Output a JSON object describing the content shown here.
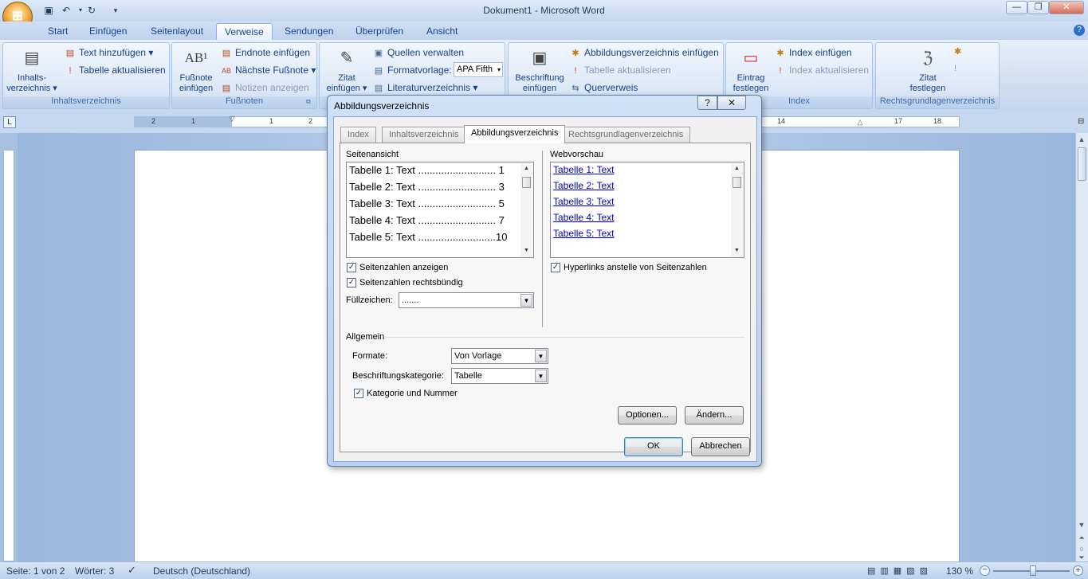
{
  "window": {
    "title": "Dokument1 - Microsoft Word"
  },
  "qat": {
    "save_icon": "save-icon",
    "undo_icon": "undo-icon",
    "redo_icon": "redo-icon"
  },
  "tabs": [
    "Start",
    "Einfügen",
    "Seitenlayout",
    "Verweise",
    "Sendungen",
    "Überprüfen",
    "Ansicht"
  ],
  "active_tab": "Verweise",
  "ribbon": {
    "inhaltsverzeichnis": {
      "label": "Inhaltsverzeichnis",
      "big": "Inhalts-\nverzeichnis ▾",
      "items": [
        "Text hinzufügen ▾",
        "Tabelle aktualisieren"
      ]
    },
    "fussnoten": {
      "label": "Fußnoten",
      "big": "Fußnote\neinfügen",
      "items": [
        "Endnote einfügen",
        "Nächste Fußnote ▾",
        "Notizen anzeigen"
      ]
    },
    "zitate": {
      "big": "Zitat\neinfügen ▾",
      "items": [
        "Quellen verwalten",
        "Formatvorlage:",
        "Literaturverzeichnis ▾"
      ],
      "style_value": "APA Fifth"
    },
    "beschriftungen": {
      "big": "Beschriftung\neinfügen",
      "items": [
        "Abbildungsverzeichnis einfügen",
        "Tabelle aktualisieren",
        "Querverweis"
      ]
    },
    "index": {
      "label": "Index",
      "big": "Eintrag\nfestlegen",
      "items": [
        "Index einfügen",
        "Index aktualisieren"
      ]
    },
    "rechtsgrundlagen": {
      "label": "Rechtsgrundlagenverzeichnis",
      "big": "Zitat\nfestlegen"
    }
  },
  "ruler": {
    "left_marks": [
      "2",
      "1"
    ],
    "marks": [
      "1",
      "2",
      "14",
      "17",
      "18"
    ]
  },
  "status": {
    "page": "Seite: 1 von 2",
    "words": "Wörter: 3",
    "language": "Deutsch (Deutschland)",
    "zoom": "130 %"
  },
  "dialog": {
    "title": "Abbildungsverzeichnis",
    "help": "?",
    "close": "✕",
    "tabs": [
      "Index",
      "Inhaltsverzeichnis",
      "Abbildungsverzeichnis",
      "Rechtsgrundlagenverzeichnis"
    ],
    "active_tab": "Abbildungsverzeichnis",
    "seitenansicht_label": "Seitenansicht",
    "webvorschau_label": "Webvorschau",
    "print_preview": [
      "Tabelle 1: Text ........................... 1",
      "Tabelle 2: Text ........................... 3",
      "Tabelle 3: Text ........................... 5",
      "Tabelle 4: Text ........................... 7",
      "Tabelle 5: Text ...........................10"
    ],
    "web_preview": [
      "Tabelle 1: Text",
      "Tabelle 2: Text",
      "Tabelle 3: Text",
      "Tabelle 4: Text",
      "Tabelle 5: Text"
    ],
    "show_page_numbers": "Seitenzahlen anzeigen",
    "right_align": "Seitenzahlen rechtsbündig",
    "hyperlinks": "Hyperlinks anstelle von Seitenzahlen",
    "fill_label": "Füllzeichen:",
    "fill_value": ".......",
    "allgemein": "Allgemein",
    "formate_label": "Formate:",
    "formate_value": "Von Vorlage",
    "kategorie_label": "Beschriftungskategorie:",
    "kategorie_value": "Tabelle",
    "kategorie_nummer": "Kategorie und Nummer",
    "optionen": "Optionen...",
    "aendern": "Ändern...",
    "ok": "OK",
    "abbrechen": "Abbrechen"
  }
}
